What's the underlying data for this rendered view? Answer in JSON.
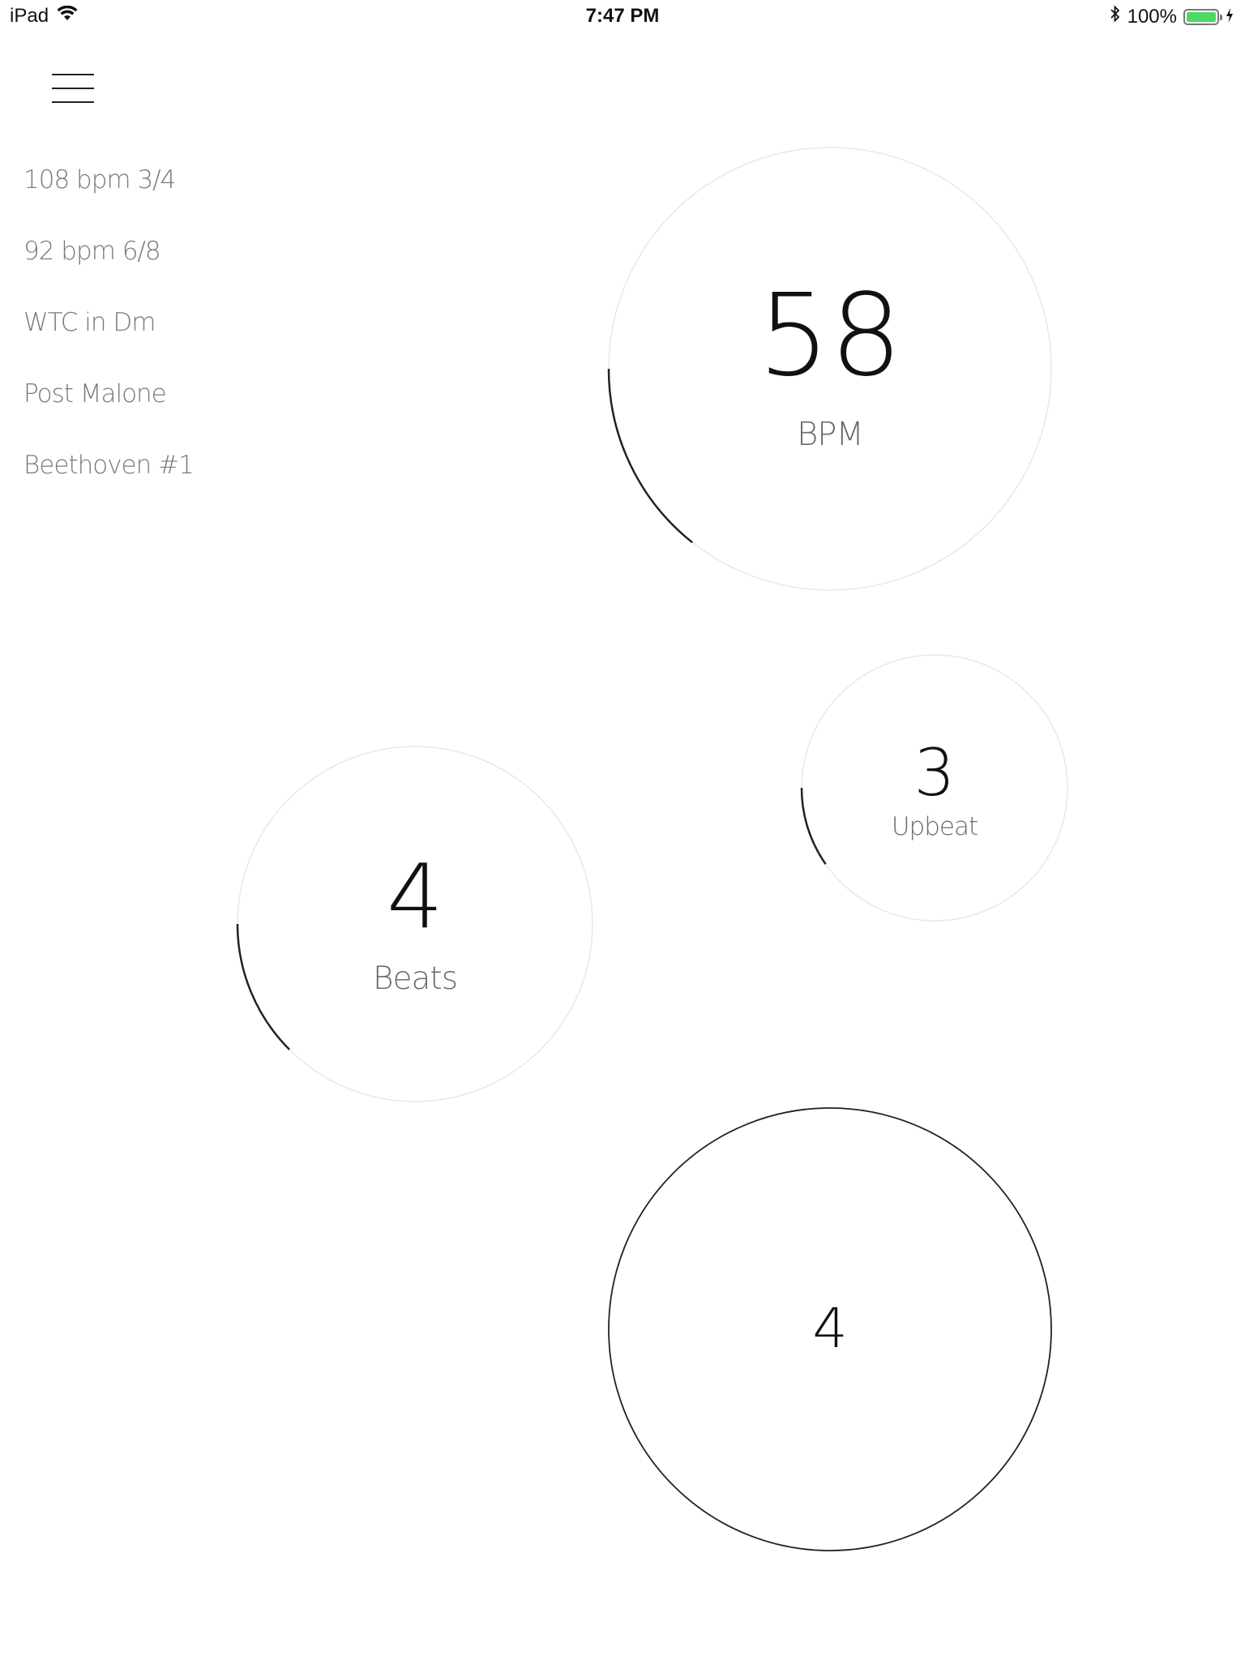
{
  "status_bar": {
    "device": "iPad",
    "time": "7:47 PM",
    "battery_text": "100%",
    "battery_level": 1.0,
    "icons": [
      "wifi-icon",
      "bluetooth-icon",
      "battery-icon",
      "charging-icon"
    ],
    "battery_color": "#4cd964"
  },
  "menu": {
    "icon": "hamburger-menu-icon"
  },
  "presets": [
    {
      "label": "108 bpm 3/4"
    },
    {
      "label": "92 bpm 6/8"
    },
    {
      "label": "WTC in Dm"
    },
    {
      "label": "Post Malone"
    },
    {
      "label": "Beethoven #1"
    }
  ],
  "bpm_dial": {
    "value": "58",
    "label": "BPM"
  },
  "upbeat_dial": {
    "value": "3",
    "label": "Upbeat"
  },
  "beats_dial": {
    "value": "4",
    "label": "Beats"
  },
  "counter_dial": {
    "value": "4"
  },
  "colors": {
    "ring_track": "#e8e8e8",
    "ring_progress": "#222222",
    "preset_text": "#7a7a7a"
  }
}
